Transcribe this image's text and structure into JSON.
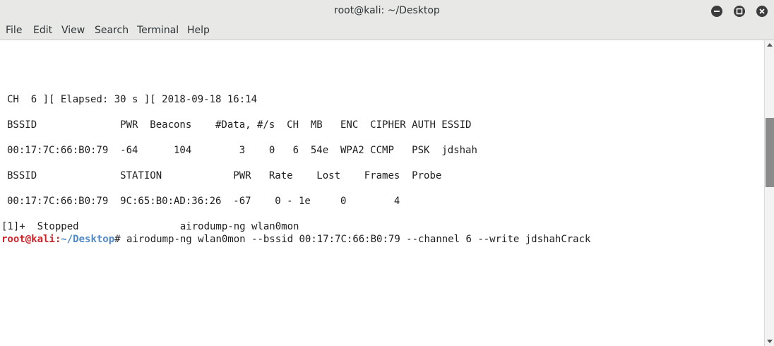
{
  "window": {
    "title": "root@kali: ~/Desktop",
    "minimize_icon": "minimize-icon",
    "maximize_icon": "maximize-icon",
    "close_icon": "close-icon"
  },
  "menu": [
    "File",
    "Edit",
    "View",
    "Search",
    "Terminal",
    "Help"
  ],
  "terminal": {
    "status_line": "CH  6 ][ Elapsed: 30 s ][ 2018-09-18 16:14",
    "ap_header": "BSSID              PWR  Beacons    #Data, #/s  CH  MB   ENC  CIPHER AUTH ESSID",
    "ap_row": "00:17:7C:66:B0:79  -64      104        3    0   6  54e  WPA2 CCMP   PSK  jdshah",
    "station_header": "BSSID              STATION            PWR   Rate    Lost    Frames  Probe",
    "station_row": "00:17:7C:66:B0:79  9C:65:B0:AD:36:26  -67    0 - 1e     0        4",
    "job_line": "[1]+  Stopped                 airodump-ng wlan0mon",
    "prompt_user": "root@kali",
    "prompt_colon": ":",
    "prompt_path": "~/Desktop",
    "prompt_symbol": "#",
    "command": " airodump-ng wlan0mon --bssid 00:17:7C:66:B0:79 --channel 6 --write jdshahCrack"
  },
  "colors": {
    "prompt_user": "#cc2127",
    "prompt_path": "#4f89c9",
    "chrome_bg": "#e8e8e7"
  }
}
